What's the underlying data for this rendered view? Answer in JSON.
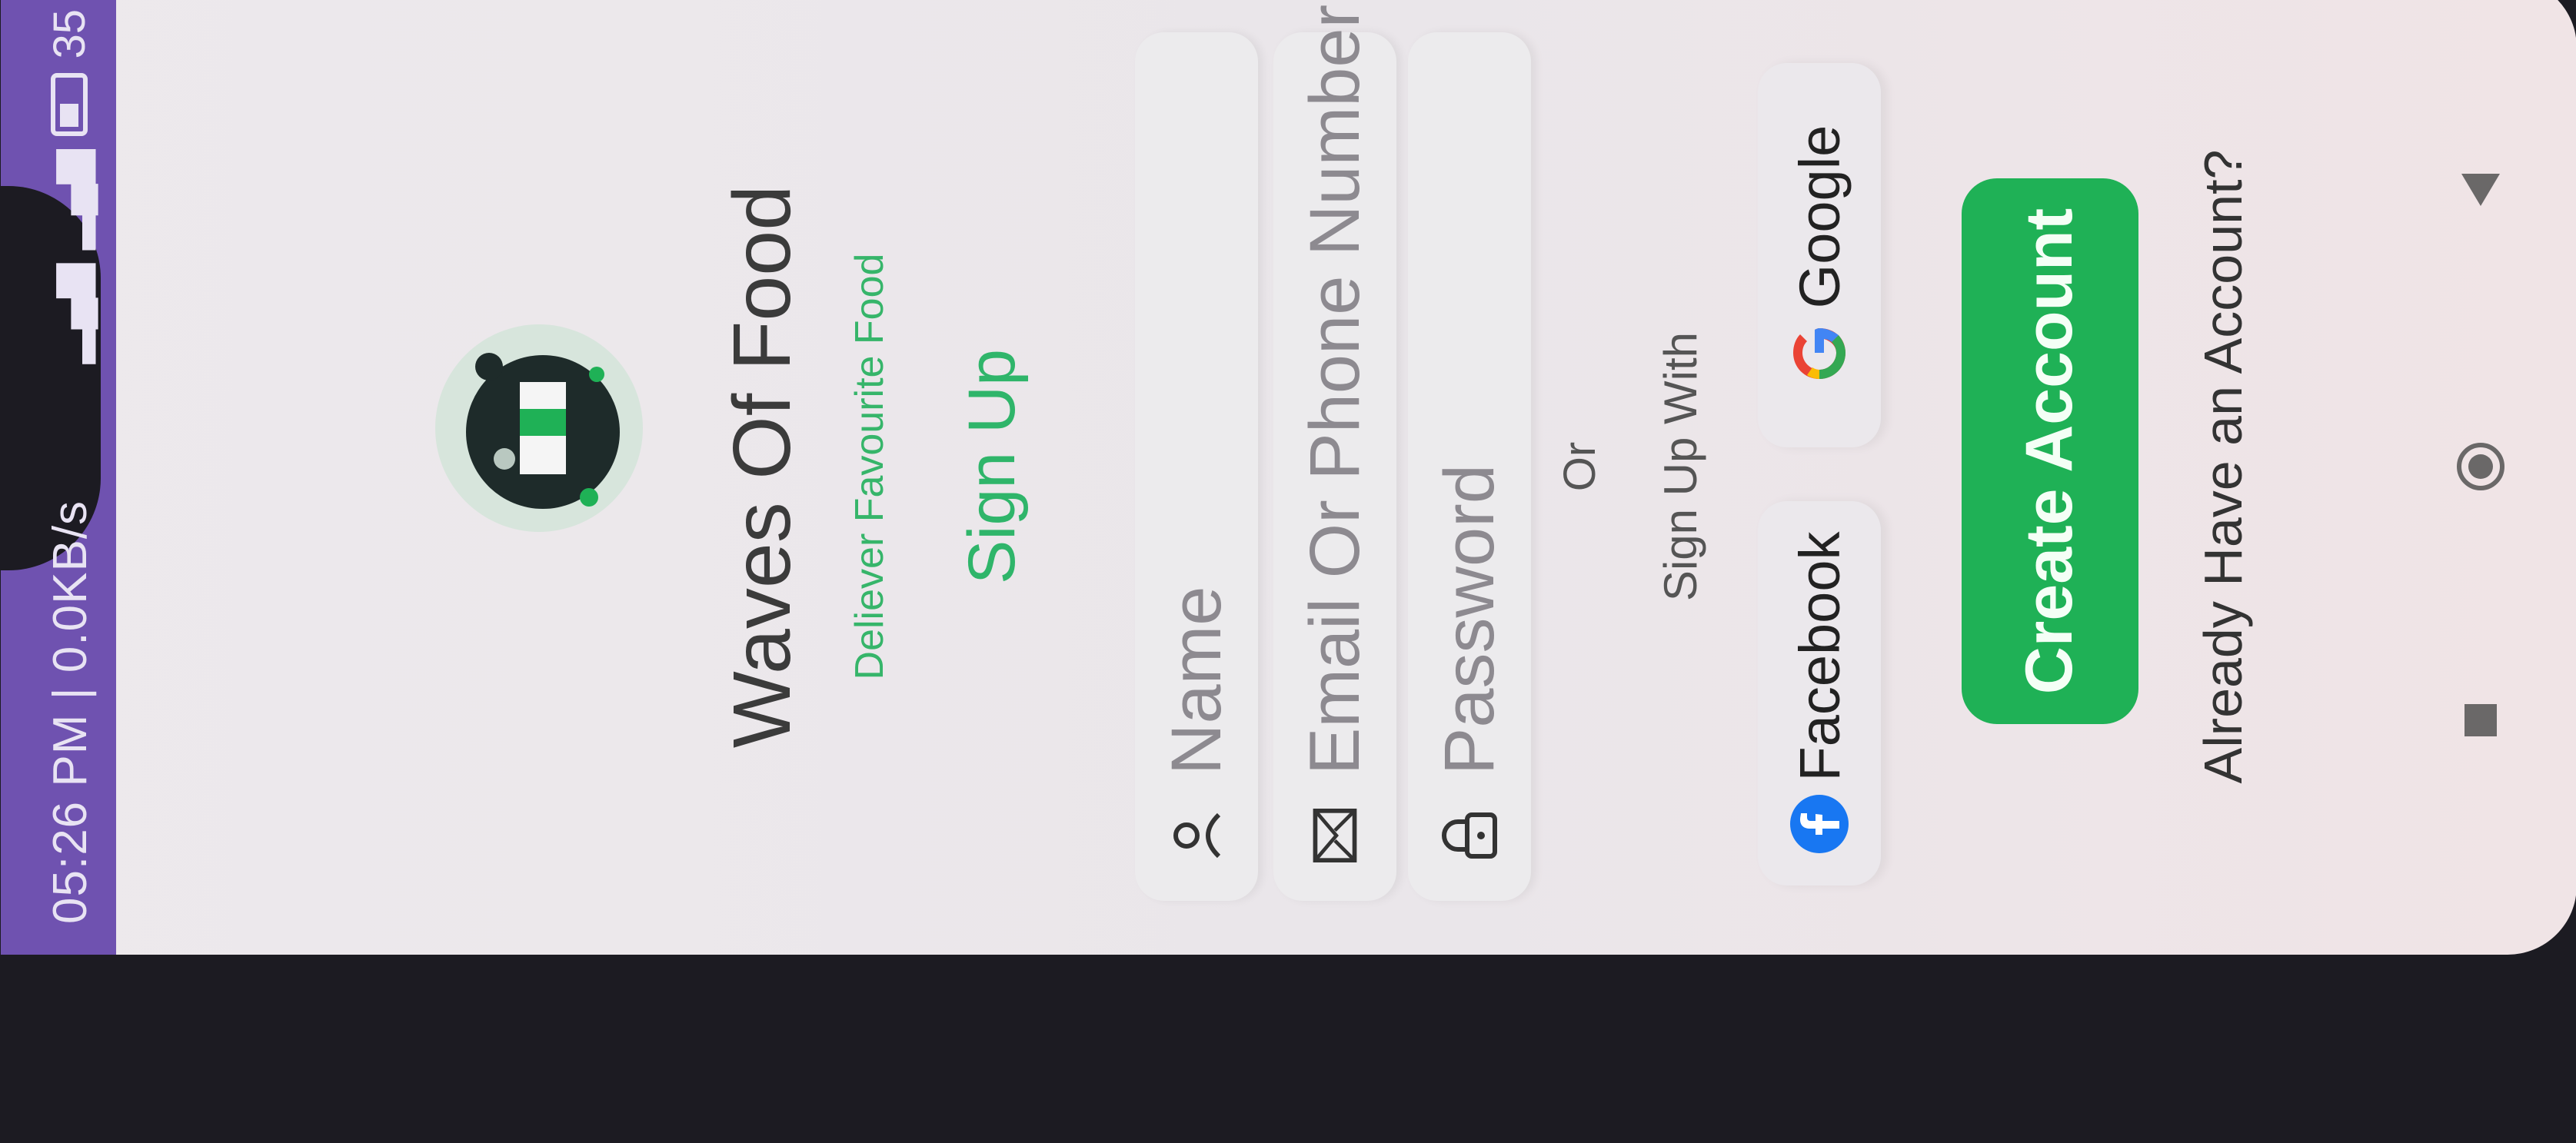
{
  "status_bar": {
    "time_speed": "05:26 PM | 0.0KB/s",
    "battery_level": "35"
  },
  "app": {
    "title": "Waves Of Food",
    "tagline": "Deliever Favourite Food",
    "screen_heading": "Sign Up"
  },
  "form": {
    "name_placeholder": "Name",
    "email_placeholder": "Email Or Phone Number",
    "password_placeholder": "Password"
  },
  "divider": {
    "or_label": "Or",
    "sign_up_with_label": "Sign Up With"
  },
  "social": {
    "facebook_label": "Facebook",
    "google_label": "Google"
  },
  "actions": {
    "create_account_label": "Create Account",
    "already_account_label": "Already Have an Account?"
  },
  "colors": {
    "accent_green": "#1fb156",
    "status_bar_purple": "#6f52b0"
  },
  "icons": {
    "name_field": "person-icon",
    "email_field": "mail-icon",
    "password_field": "lock-icon",
    "facebook": "facebook-icon",
    "google": "google-icon",
    "nav_recents": "square-icon",
    "nav_home": "circle-icon",
    "nav_back": "triangle-back-icon"
  }
}
